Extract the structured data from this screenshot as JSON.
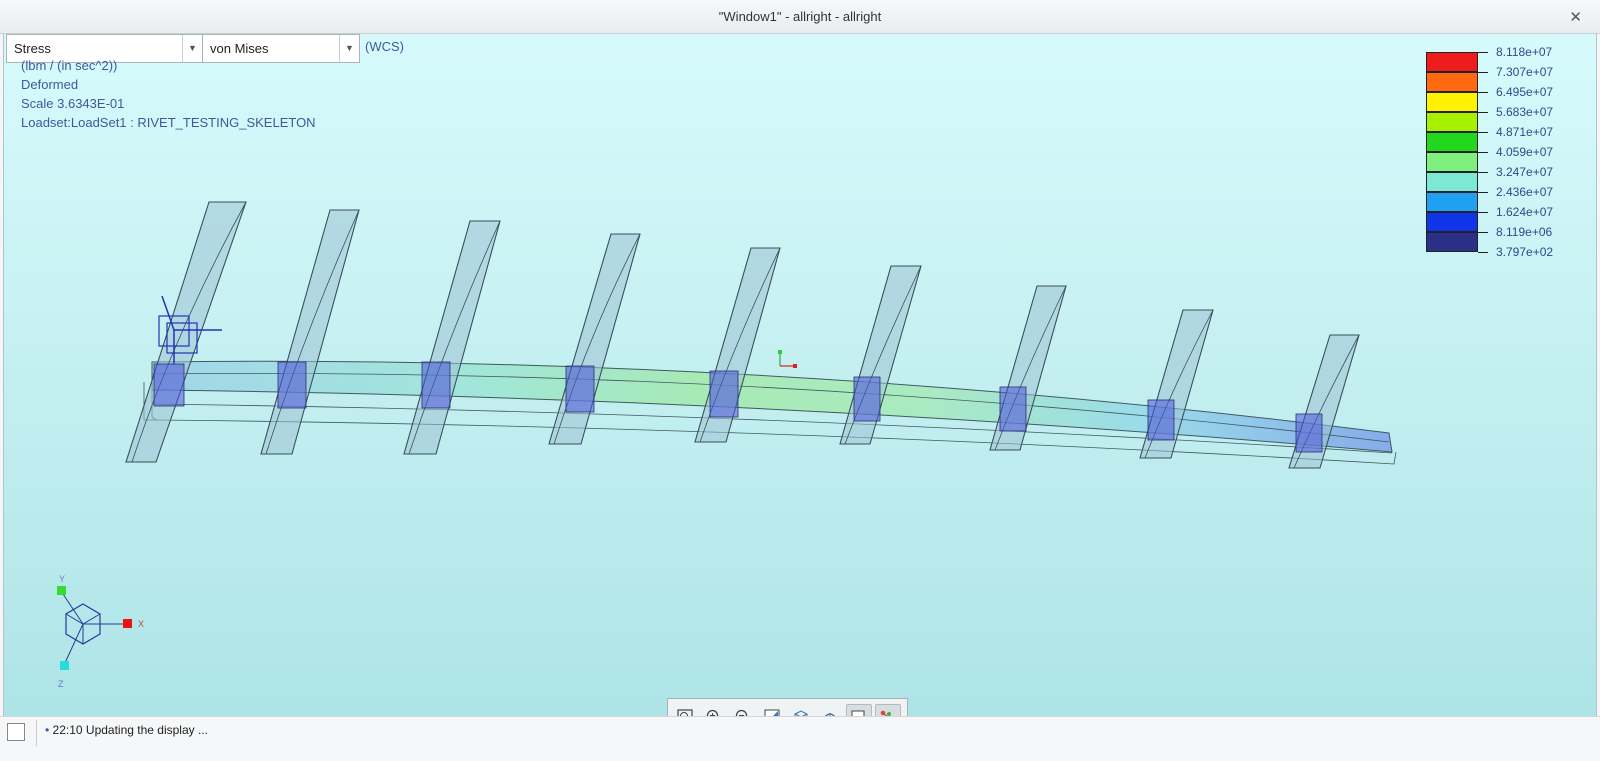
{
  "window": {
    "title": "\"Window1\" - allright - allright"
  },
  "toolbar": {
    "quantity": "Stress",
    "component": "von Mises",
    "coord_system": "(WCS)"
  },
  "info": {
    "units": "(lbm / (in sec^2))",
    "mode": "Deformed",
    "scale": "Scale  3.6343E-01",
    "loadset": "Loadset:LoadSet1 :  RIVET_TESTING_SKELETON"
  },
  "legend": {
    "labels": [
      "8.118e+07",
      "7.307e+07",
      "6.495e+07",
      "5.683e+07",
      "4.871e+07",
      "4.059e+07",
      "3.247e+07",
      "2.436e+07",
      "1.624e+07",
      "8.119e+06",
      "3.797e+02"
    ],
    "colors": [
      "#ee1c1c",
      "#ff6a10",
      "#fff200",
      "#a6f000",
      "#22d81f",
      "#7ff07f",
      "#7ee8d6",
      "#1fa0f0",
      "#1034e8",
      "#2b2f88"
    ]
  },
  "triad": {
    "x": "X",
    "y": "Y",
    "z": "Z"
  },
  "status": {
    "message": "22:10 Updating the display ..."
  },
  "colors": {
    "viewport_bg": "#c6f1f3",
    "text_blue": "#3c5a9c"
  }
}
